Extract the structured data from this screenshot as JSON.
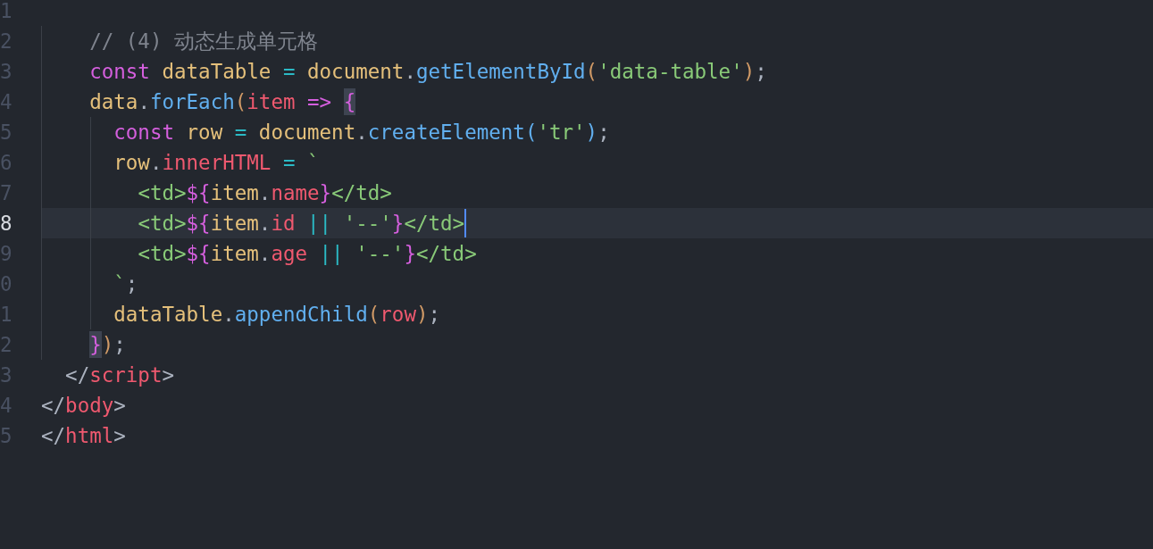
{
  "editor": {
    "lines": [
      {
        "number": "1",
        "selected": false
      },
      {
        "number": "2",
        "selected": false,
        "tokens": [
          {
            "text": "    // (4) 动态生成单元格",
            "kind": "comment"
          }
        ]
      },
      {
        "number": "3",
        "selected": false,
        "tokens": [
          {
            "text": "    const",
            "kind": "keyword"
          },
          {
            "text": " dataTable",
            "kind": "variable"
          },
          {
            "text": " =",
            "kind": "operator"
          },
          {
            "text": " document",
            "kind": "variable"
          },
          {
            "text": ".",
            "kind": "punctuation"
          },
          {
            "text": "getElementById",
            "kind": "function"
          },
          {
            "text": "(",
            "kind": "paren"
          },
          {
            "text": "'data-table'",
            "kind": "string"
          },
          {
            "text": ")",
            "kind": "paren"
          },
          {
            "text": ";",
            "kind": "punctuation"
          }
        ]
      },
      {
        "number": "4",
        "selected": false,
        "tokens": [
          {
            "text": "    data",
            "kind": "variable"
          },
          {
            "text": ".",
            "kind": "punctuation"
          },
          {
            "text": "forEach",
            "kind": "function"
          },
          {
            "text": "(",
            "kind": "paren"
          },
          {
            "text": "item",
            "kind": "property"
          },
          {
            "text": " => ",
            "kind": "keyword"
          },
          {
            "text": "{",
            "kind": "brace",
            "matched": true
          }
        ]
      },
      {
        "number": "5",
        "selected": false,
        "tokens": [
          {
            "text": "      const",
            "kind": "keyword"
          },
          {
            "text": " row",
            "kind": "variable"
          },
          {
            "text": " =",
            "kind": "operator"
          },
          {
            "text": " document",
            "kind": "variable"
          },
          {
            "text": ".",
            "kind": "punctuation"
          },
          {
            "text": "createElement",
            "kind": "function"
          },
          {
            "text": "(",
            "kind": "function"
          },
          {
            "text": "'tr'",
            "kind": "string"
          },
          {
            "text": ")",
            "kind": "function"
          },
          {
            "text": ";",
            "kind": "punctuation"
          }
        ]
      },
      {
        "number": "6",
        "selected": false,
        "tokens": [
          {
            "text": "      row",
            "kind": "variable"
          },
          {
            "text": ".",
            "kind": "punctuation"
          },
          {
            "text": "innerHTML",
            "kind": "property"
          },
          {
            "text": " =",
            "kind": "operator"
          },
          {
            "text": " `",
            "kind": "string"
          }
        ]
      },
      {
        "number": "7",
        "selected": false,
        "tokens": [
          {
            "text": "        <td>",
            "kind": "string"
          },
          {
            "text": "${",
            "kind": "brace"
          },
          {
            "text": "item",
            "kind": "variable"
          },
          {
            "text": ".",
            "kind": "punctuation"
          },
          {
            "text": "name",
            "kind": "property"
          },
          {
            "text": "}",
            "kind": "brace"
          },
          {
            "text": "</td>",
            "kind": "string"
          }
        ]
      },
      {
        "number": "8",
        "selected": true,
        "tokens": [
          {
            "text": "        <td>",
            "kind": "string"
          },
          {
            "text": "${",
            "kind": "brace"
          },
          {
            "text": "item",
            "kind": "variable"
          },
          {
            "text": ".",
            "kind": "punctuation"
          },
          {
            "text": "id",
            "kind": "property"
          },
          {
            "text": " ||",
            "kind": "operator"
          },
          {
            "text": " '--'",
            "kind": "string"
          },
          {
            "text": "}",
            "kind": "brace"
          },
          {
            "text": "</td>",
            "kind": "string"
          }
        ]
      },
      {
        "number": "9",
        "selected": false,
        "tokens": [
          {
            "text": "        <td>",
            "kind": "string"
          },
          {
            "text": "${",
            "kind": "brace"
          },
          {
            "text": "item",
            "kind": "variable"
          },
          {
            "text": ".",
            "kind": "punctuation"
          },
          {
            "text": "age",
            "kind": "property"
          },
          {
            "text": " ||",
            "kind": "operator"
          },
          {
            "text": " '--'",
            "kind": "string"
          },
          {
            "text": "}",
            "kind": "brace"
          },
          {
            "text": "</td>",
            "kind": "string"
          }
        ]
      },
      {
        "number": "0",
        "selected": false,
        "tokens": [
          {
            "text": "      `",
            "kind": "string"
          },
          {
            "text": ";",
            "kind": "punctuation"
          }
        ]
      },
      {
        "number": "1",
        "selected": false,
        "tokens": [
          {
            "text": "      dataTable",
            "kind": "variable"
          },
          {
            "text": ".",
            "kind": "punctuation"
          },
          {
            "text": "appendChild",
            "kind": "function"
          },
          {
            "text": "(",
            "kind": "paren"
          },
          {
            "text": "row",
            "kind": "property"
          },
          {
            "text": ")",
            "kind": "paren"
          },
          {
            "text": ";",
            "kind": "punctuation"
          }
        ]
      },
      {
        "number": "2",
        "selected": false,
        "tokens": [
          {
            "text": "    }",
            "kind": "brace",
            "matched": true
          },
          {
            "text": ")",
            "kind": "paren"
          },
          {
            "text": ";",
            "kind": "punctuation"
          }
        ]
      },
      {
        "number": "3",
        "selected": false,
        "tokens": [
          {
            "text": "  </",
            "kind": "punctuation"
          },
          {
            "text": "script",
            "kind": "property"
          },
          {
            "text": ">",
            "kind": "punctuation"
          }
        ]
      },
      {
        "number": "4",
        "selected": false,
        "tokens": [
          {
            "text": "</",
            "kind": "punctuation"
          },
          {
            "text": "body",
            "kind": "property"
          },
          {
            "text": ">",
            "kind": "punctuation"
          }
        ]
      },
      {
        "number": "5",
        "selected": false,
        "tokens": [
          {
            "text": "</",
            "kind": "punctuation"
          },
          {
            "text": "html",
            "kind": "property"
          },
          {
            "text": ">",
            "kind": "punctuation"
          }
        ]
      }
    ]
  }
}
